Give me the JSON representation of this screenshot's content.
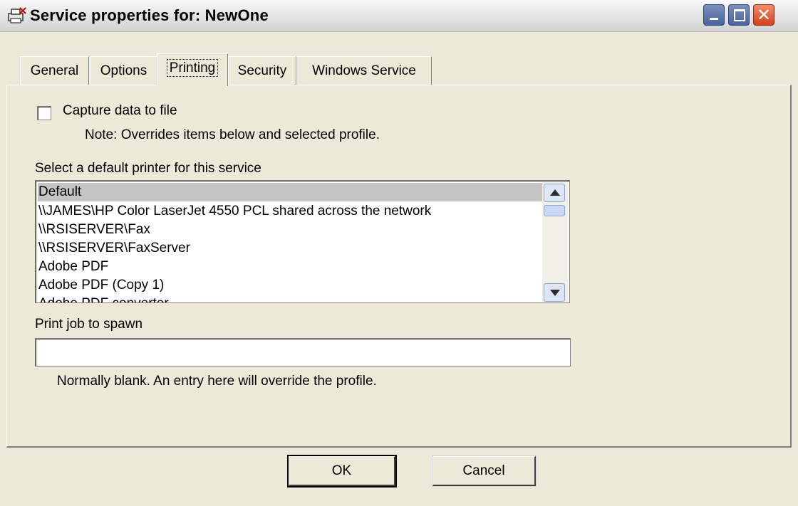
{
  "window": {
    "title": "Service properties for: NewOne",
    "close_glyph": "✕",
    "icons": [
      "app-icon",
      "minimize-icon",
      "maximize-icon",
      "close-icon"
    ]
  },
  "tabs": [
    {
      "label": "General"
    },
    {
      "label": "Options"
    },
    {
      "label": "Printing",
      "active": true
    },
    {
      "label": "Security"
    },
    {
      "label": "Windows Service"
    }
  ],
  "printing": {
    "capture_label": "Capture data to file",
    "capture_checked": false,
    "capture_note": "Note: Overrides items below and selected profile.",
    "printer_label": "Select a default printer for this service",
    "printers": [
      "Default",
      "\\\\JAMES\\HP Color LaserJet 4550 PCL shared across the network",
      "\\\\RSISERVER\\Fax",
      "\\\\RSISERVER\\FaxServer",
      "Adobe PDF",
      "Adobe PDF (Copy 1)",
      "Adobe PDF converter"
    ],
    "selected_printer": "Default",
    "job_label": "Print job to spawn",
    "job_value": "",
    "job_note": "Normally blank.  An entry here will override the profile."
  },
  "buttons": {
    "ok": "OK",
    "cancel": "Cancel"
  }
}
